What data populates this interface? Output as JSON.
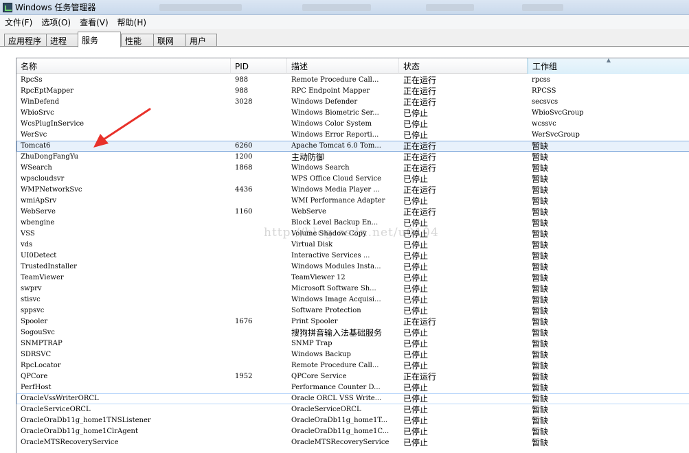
{
  "window": {
    "title": "Windows 任务管理器"
  },
  "menu": [
    {
      "label": "文件(F)"
    },
    {
      "label": "选项(O)"
    },
    {
      "label": "查看(V)"
    },
    {
      "label": "帮助(H)"
    }
  ],
  "tabs": [
    {
      "label": "应用程序"
    },
    {
      "label": "进程"
    },
    {
      "label": "服务"
    },
    {
      "label": "性能"
    },
    {
      "label": "联网"
    },
    {
      "label": "用户"
    }
  ],
  "active_tab": "服务",
  "columns": {
    "name": "名称",
    "pid": "PID",
    "desc": "描述",
    "status": "状态",
    "group": "工作组"
  },
  "sorted_column": "工作组",
  "rows": [
    {
      "name": "RpcSs",
      "pid": "988",
      "desc": "Remote Procedure Call...",
      "status": "正在运行",
      "group": "rpcss"
    },
    {
      "name": "RpcEptMapper",
      "pid": "988",
      "desc": "RPC Endpoint Mapper",
      "status": "正在运行",
      "group": "RPCSS"
    },
    {
      "name": "WinDefend",
      "pid": "3028",
      "desc": "Windows Defender",
      "status": "正在运行",
      "group": "secsvcs"
    },
    {
      "name": "WbioSrvc",
      "pid": "",
      "desc": "Windows Biometric Ser...",
      "status": "已停止",
      "group": "WbioSvcGroup"
    },
    {
      "name": "WcsPlugInService",
      "pid": "",
      "desc": "Windows Color System",
      "status": "已停止",
      "group": "wcssvc"
    },
    {
      "name": "WerSvc",
      "pid": "",
      "desc": "Windows Error Reporti...",
      "status": "已停止",
      "group": "WerSvcGroup"
    },
    {
      "name": "Tomcat6",
      "pid": "6260",
      "desc": "Apache Tomcat 6.0 Tom...",
      "status": "正在运行",
      "group": "暂缺"
    },
    {
      "name": "ZhuDongFangYu",
      "pid": "1200",
      "desc": "主动防御",
      "status": "正在运行",
      "group": "暂缺"
    },
    {
      "name": "WSearch",
      "pid": "1868",
      "desc": "Windows Search",
      "status": "正在运行",
      "group": "暂缺"
    },
    {
      "name": "wpscloudsvr",
      "pid": "",
      "desc": "WPS Office Cloud Service",
      "status": "已停止",
      "group": "暂缺"
    },
    {
      "name": "WMPNetworkSvc",
      "pid": "4436",
      "desc": "Windows Media Player ...",
      "status": "正在运行",
      "group": "暂缺"
    },
    {
      "name": "wmiApSrv",
      "pid": "",
      "desc": "WMI Performance Adapter",
      "status": "已停止",
      "group": "暂缺"
    },
    {
      "name": "WebServe",
      "pid": "1160",
      "desc": "WebServe",
      "status": "正在运行",
      "group": "暂缺"
    },
    {
      "name": "wbengine",
      "pid": "",
      "desc": "Block Level Backup En...",
      "status": "已停止",
      "group": "暂缺"
    },
    {
      "name": "VSS",
      "pid": "",
      "desc": "Volume Shadow Copy",
      "status": "已停止",
      "group": "暂缺"
    },
    {
      "name": "vds",
      "pid": "",
      "desc": "Virtual Disk",
      "status": "已停止",
      "group": "暂缺"
    },
    {
      "name": "UI0Detect",
      "pid": "",
      "desc": "Interactive Services ...",
      "status": "已停止",
      "group": "暂缺"
    },
    {
      "name": "TrustedInstaller",
      "pid": "",
      "desc": "Windows Modules Insta...",
      "status": "已停止",
      "group": "暂缺"
    },
    {
      "name": "TeamViewer",
      "pid": "",
      "desc": "TeamViewer 12",
      "status": "已停止",
      "group": "暂缺"
    },
    {
      "name": "swprv",
      "pid": "",
      "desc": "Microsoft Software Sh...",
      "status": "已停止",
      "group": "暂缺"
    },
    {
      "name": "stisvc",
      "pid": "",
      "desc": "Windows Image Acquisi...",
      "status": "已停止",
      "group": "暂缺"
    },
    {
      "name": "sppsvc",
      "pid": "",
      "desc": "Software Protection",
      "status": "已停止",
      "group": "暂缺"
    },
    {
      "name": "Spooler",
      "pid": "1676",
      "desc": "Print Spooler",
      "status": "正在运行",
      "group": "暂缺"
    },
    {
      "name": "SogouSvc",
      "pid": "",
      "desc": "搜狗拼音输入法基础服务",
      "status": "已停止",
      "group": "暂缺"
    },
    {
      "name": "SNMPTRAP",
      "pid": "",
      "desc": "SNMP Trap",
      "status": "已停止",
      "group": "暂缺"
    },
    {
      "name": "SDRSVC",
      "pid": "",
      "desc": "Windows Backup",
      "status": "已停止",
      "group": "暂缺"
    },
    {
      "name": "RpcLocator",
      "pid": "",
      "desc": "Remote Procedure Call...",
      "status": "已停止",
      "group": "暂缺"
    },
    {
      "name": "QPCore",
      "pid": "1952",
      "desc": "QPCore Service",
      "status": "正在运行",
      "group": "暂缺"
    },
    {
      "name": "PerfHost",
      "pid": "",
      "desc": "Performance Counter D...",
      "status": "已停止",
      "group": "暂缺"
    },
    {
      "name": "OracleVssWriterORCL",
      "pid": "",
      "desc": "Oracle ORCL VSS Write...",
      "status": "已停止",
      "group": "暂缺"
    },
    {
      "name": "OracleServiceORCL",
      "pid": "",
      "desc": "OracleServiceORCL",
      "status": "已停止",
      "group": "暂缺"
    },
    {
      "name": "OracleOraDb11g_home1TNSListener",
      "pid": "",
      "desc": "OracleOraDb11g_home1T...",
      "status": "已停止",
      "group": "暂缺"
    },
    {
      "name": "OracleOraDb11g_home1ClrAgent",
      "pid": "",
      "desc": "OracleOraDb11g_home1C...",
      "status": "已停止",
      "group": "暂缺"
    },
    {
      "name": "OracleMTSRecoveryService",
      "pid": "",
      "desc": "OracleMTSRecoveryService",
      "status": "已停止",
      "group": "暂缺"
    }
  ],
  "selected_row_name": "Tomcat6",
  "focused_row_name": "OracleVssWriterORCL",
  "watermark": "http://blog.csdn.net/u0104",
  "colors": {
    "selection_border": "#84acdd",
    "annotation_arrow": "#e8312a"
  }
}
